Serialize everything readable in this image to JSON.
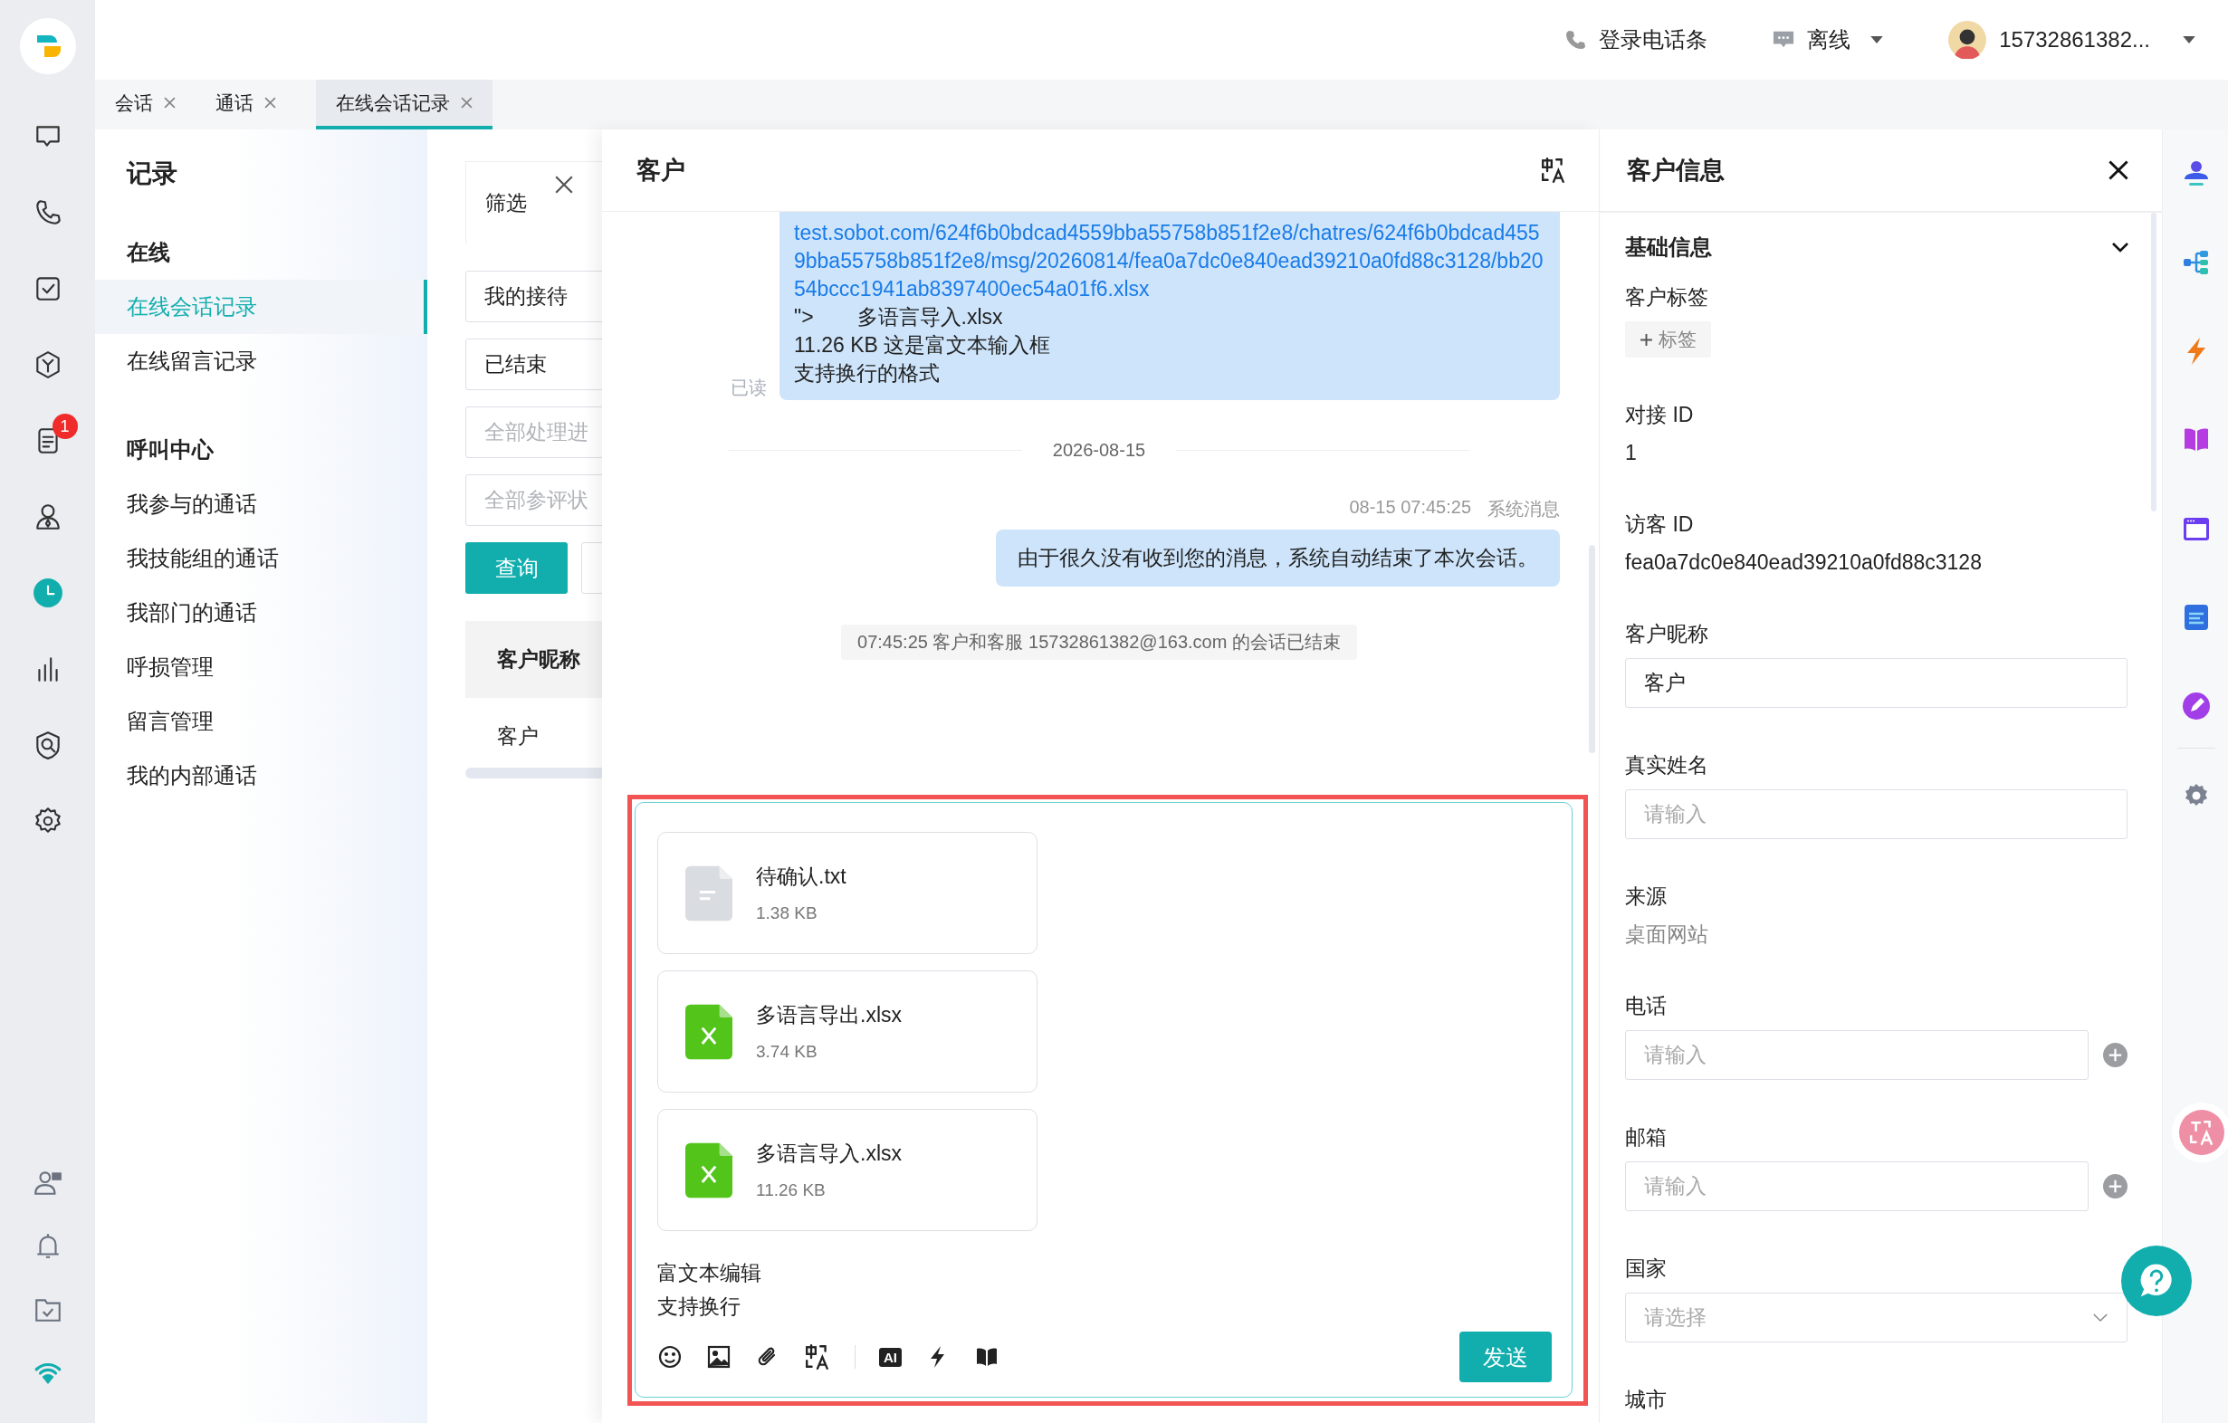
{
  "rail": {
    "items": [
      {
        "selected": false
      },
      {
        "selected": false
      },
      {
        "selected": false
      },
      {
        "selected": false
      },
      {
        "selected": false,
        "badge": "1"
      },
      {
        "selected": false
      },
      {
        "selected": true
      },
      {
        "selected": false
      },
      {
        "selected": false
      },
      {
        "selected": false
      }
    ]
  },
  "top_bar": {
    "phone_bar": "登录电话条",
    "status": "离线",
    "user": "15732861382..."
  },
  "tabs": [
    {
      "label": "会话",
      "selected": false
    },
    {
      "label": "通话",
      "selected": false
    },
    {
      "label": "在线会话记录",
      "selected": true
    }
  ],
  "nav": {
    "title": "记录",
    "sections": [
      {
        "title": "在线",
        "items": [
          {
            "label": "在线会话记录",
            "selected": true
          },
          {
            "label": "在线留言记录",
            "selected": false
          }
        ]
      },
      {
        "title": "呼叫中心",
        "items": [
          {
            "label": "我参与的通话",
            "selected": false
          },
          {
            "label": "我技能组的通话",
            "selected": false
          },
          {
            "label": "我部门的通话",
            "selected": false
          },
          {
            "label": "呼损管理",
            "selected": false
          },
          {
            "label": "留言管理",
            "selected": false
          },
          {
            "label": "我的内部通话",
            "selected": false
          }
        ]
      }
    ]
  },
  "filter": {
    "title": "筛选",
    "fields": [
      {
        "value": "我的接待"
      },
      {
        "value": "已结束"
      },
      {
        "placeholder": "全部处理进"
      },
      {
        "placeholder": "全部参评状"
      }
    ],
    "query_button": "查询",
    "table": {
      "columns": [
        "客户昵称"
      ],
      "rows": [
        [
          "客户"
        ]
      ]
    }
  },
  "chat": {
    "title": "客户",
    "messages": [
      {
        "kind": "file_bubble",
        "read": "已读",
        "link": "test.sobot.com/624f6b0bdcad4559bba55758b851f2e8/chatres/624f6b0bdcad4559bba55758b851f2e8/msg/20260814/fea0a7dc0e840ead39210a0fd88c3128/bb2054bccc1941ab8397400ec54a01f6.xlsx",
        "after": "\">",
        "file": "多语言导入.xlsx",
        "lines": [
          "11.26 KB   这是富文本输入框",
          "支持换行的格式"
        ]
      },
      {
        "kind": "date",
        "text": "2026-08-15"
      },
      {
        "kind": "bubble",
        "time": "08-15 07:45:25",
        "sender": "系统消息",
        "text": "由于很久没有收到您的消息，系统自动结束了本次会话。"
      },
      {
        "kind": "note",
        "text": "07:45:25 客户和客服 15732861382@163.com 的会话已结束"
      }
    ],
    "composer": {
      "attachments": [
        {
          "kind": "txt",
          "name": "待确认.txt",
          "size": "1.38 KB"
        },
        {
          "kind": "xlsx",
          "name": "多语言导出.xlsx",
          "size": "3.74 KB"
        },
        {
          "kind": "xlsx",
          "name": "多语言导入.xlsx",
          "size": "11.26 KB"
        }
      ],
      "lines": [
        "富文本编辑",
        "支持换行"
      ],
      "ai_label": "AI",
      "send_button": "发送"
    }
  },
  "customer_info": {
    "title": "客户信息",
    "section": {
      "title": "基础信息",
      "expanded": true
    },
    "fields": [
      {
        "kind": "tags",
        "label": "客户标签",
        "button": "标签"
      },
      {
        "kind": "text",
        "label": "对接 ID",
        "value": "1"
      },
      {
        "kind": "text",
        "label": "访客 ID",
        "value": "fea0a7dc0e840ead39210a0fd88c3128"
      },
      {
        "kind": "input",
        "label": "客户昵称",
        "value": "客户",
        "addable": false
      },
      {
        "kind": "input",
        "label": "真实姓名",
        "placeholder": "请输入",
        "addable": false
      },
      {
        "kind": "readonly",
        "label": "来源",
        "value": "桌面网站"
      },
      {
        "kind": "input",
        "label": "电话",
        "placeholder": "请输入",
        "addable": true
      },
      {
        "kind": "input",
        "label": "邮箱",
        "placeholder": "请输入",
        "addable": true
      },
      {
        "kind": "select",
        "label": "国家",
        "placeholder": "请选择"
      },
      {
        "kind": "label",
        "label": "城市"
      }
    ]
  }
}
